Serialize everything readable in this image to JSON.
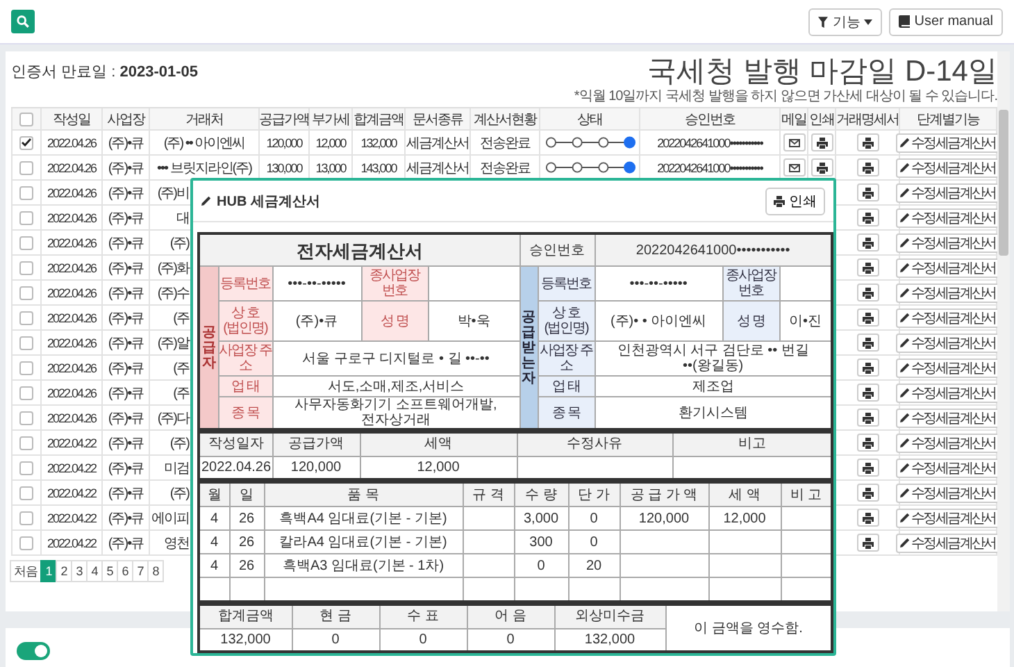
{
  "topbar": {
    "function_button": "기능",
    "manual_button": "User manual"
  },
  "header": {
    "expiry": "인증서 만료일 : **2023-01-05**",
    "deadline": "국세청 발행 마감일 D-14일",
    "note": "*익월 10일까지 국세청 발행을 하지 않으면 가산세 대상이 될 수 있습니다."
  },
  "table": {
    "select_all_checked": false,
    "columns": [
      "작성일",
      "사업장",
      "거래처",
      "공급가액",
      "부가세",
      "합계금액",
      "문서종류",
      "계산서현황",
      "상태",
      "승인번호",
      "메일",
      "인쇄",
      "거래명세서",
      "단계별기능"
    ],
    "rows": [
      {
        "kind": "full",
        "checked": true,
        "date": "2022.04.26",
        "branch": "(주)•큐",
        "client": "(주) •• 아이엔씨",
        "supply": "120,000",
        "vat": "12,000",
        "total": "132,000",
        "doc_type": "세금계산서",
        "status": "전송완료",
        "stages": [
          {
            "selected": false
          },
          {
            "selected": false
          },
          {
            "selected": false
          },
          {
            "selected": true
          }
        ],
        "approval_no": "2022042641000•••••••••••",
        "action": "수정세금계산서"
      },
      {
        "kind": "full",
        "checked": false,
        "date": "2022.04.26",
        "branch": "(주)•큐",
        "client": "••• 브릿지라인(주)",
        "supply": "130,000",
        "vat": "13,000",
        "total": "143,000",
        "doc_type": "세금계산서",
        "status": "전송완료",
        "stages": [
          {
            "selected": false
          },
          {
            "selected": false
          },
          {
            "selected": false
          },
          {
            "selected": true
          }
        ],
        "approval_no": "2022042641000•••••••••••",
        "action": "수정세금계산서"
      },
      {
        "kind": "covered",
        "checked": false,
        "date": "2022.04.26",
        "branch": "(주)•큐",
        "client": "(주)비",
        "action": "수정세금계산서"
      },
      {
        "kind": "covered",
        "checked": false,
        "date": "2022.04.26",
        "branch": "(주)•큐",
        "client": "대",
        "action": "수정세금계산서"
      },
      {
        "kind": "covered",
        "checked": false,
        "date": "2022.04.26",
        "branch": "(주)•큐",
        "client": "(주)",
        "action": "수정세금계산서"
      },
      {
        "kind": "covered",
        "checked": false,
        "date": "2022.04.26",
        "branch": "(주)•큐",
        "client": "(주)화",
        "action": "수정세금계산서"
      },
      {
        "kind": "covered",
        "checked": false,
        "date": "2022.04.26",
        "branch": "(주)•큐",
        "client": "(주)수",
        "action": "수정세금계산서"
      },
      {
        "kind": "covered",
        "checked": false,
        "date": "2022.04.26",
        "branch": "(주)•큐",
        "client": "(주",
        "action": "수정세금계산서"
      },
      {
        "kind": "covered",
        "checked": false,
        "date": "2022.04.26",
        "branch": "(주)•큐",
        "client": "(주)알",
        "action": "수정세금계산서"
      },
      {
        "kind": "covered",
        "checked": false,
        "date": "2022.04.26",
        "branch": "(주)•큐",
        "client": "(주",
        "action": "수정세금계산서"
      },
      {
        "kind": "covered",
        "checked": false,
        "date": "2022.04.26",
        "branch": "(주)•큐",
        "client": "(주",
        "action": "수정세금계산서"
      },
      {
        "kind": "covered",
        "checked": false,
        "date": "2022.04.26",
        "branch": "(주)•큐",
        "client": "(주)다",
        "action": "수정세금계산서"
      },
      {
        "kind": "covered",
        "checked": false,
        "date": "2022.04.22",
        "branch": "(주)•큐",
        "client": "(주)",
        "action": "수정세금계산서"
      },
      {
        "kind": "covered",
        "checked": false,
        "date": "2022.04.22",
        "branch": "(주)•큐",
        "client": "미검",
        "action": "수정세금계산서"
      },
      {
        "kind": "covered",
        "checked": false,
        "date": "2022.04.22",
        "branch": "(주)•큐",
        "client": "(주)",
        "action": "수정세금계산서"
      },
      {
        "kind": "covered",
        "checked": false,
        "date": "2022.04.22",
        "branch": "(주)•큐",
        "client": "에이피",
        "action": "수정세금계산서"
      },
      {
        "kind": "covered",
        "checked": false,
        "date": "2022.04.22",
        "branch": "(주)•큐",
        "client": "영천",
        "action": "수정세금계산서"
      }
    ]
  },
  "pagination": [
    {
      "label": "처음",
      "selected": false
    },
    {
      "label": "1",
      "selected": true
    },
    {
      "label": "2",
      "selected": false
    },
    {
      "label": "3",
      "selected": false
    },
    {
      "label": "4",
      "selected": false
    },
    {
      "label": "5",
      "selected": false
    },
    {
      "label": "6",
      "selected": false
    },
    {
      "label": "7",
      "selected": false
    },
    {
      "label": "8",
      "selected": false
    }
  ],
  "popup": {
    "title": "HUB 세금계산서",
    "print_button": "인쇄",
    "invoice": {
      "heading": "전자세금계산서",
      "approval_label": "승인번호",
      "approval_no": "2022042641000•••••••••••",
      "supplier": {
        "side_label": "공급자",
        "reg_label": "등록번호",
        "reg_no": "•••-••-•••••",
        "sub_label": "종사업장 번호",
        "name_label": "상 호 (법인명)",
        "name": "(주)•큐",
        "rep_label": "성 명",
        "rep": "박•욱",
        "addr_label": "사업장 주 소",
        "addr": "서울 구로구 디지털로 • 길 ••-••",
        "type_label": "업 태",
        "type": "서도,소매,제조,서비스",
        "item_label": "종 목",
        "item": "사무자동화기기 소프트웨어개발,전자상거래"
      },
      "receiver": {
        "side_label": "공급받는자",
        "reg_label": "등록번호",
        "reg_no": "•••-••-•••••",
        "sub_label": "종사업장 번호",
        "name_label": "상 호 (법인명)",
        "name": "(주)• • 아이엔씨",
        "rep_label": "성 명",
        "rep": "이•진",
        "addr_label": "사업장 주 소",
        "addr": "인천광역시 서구 검단로 •• 번길 ••(왕길동)",
        "type_label": "업 태",
        "type": "제조업",
        "item_label": "종 목",
        "item": "환기시스템"
      },
      "summary": {
        "columns": [
          "작성일자",
          "공급가액",
          "세액",
          "수정사유",
          "비고"
        ],
        "values": [
          "2022.04.26",
          "120,000",
          "12,000"
        ]
      },
      "items": {
        "columns": [
          "월",
          "일",
          "품 목",
          "규 격",
          "수 량",
          "단 가",
          "공 급 가 액",
          "세 액",
          "비 고"
        ],
        "rows": [
          {
            "month": "4",
            "day": "26",
            "name": "흑백A4 임대료(기본 - 기본)",
            "qty": "3,000",
            "price": "0",
            "supply": "120,000",
            "tax": "12,000"
          },
          {
            "month": "4",
            "day": "26",
            "name": "칼라A4 임대료(기본 - 기본)",
            "qty": "300",
            "price": "0"
          },
          {
            "month": "4",
            "day": "26",
            "name": "흑백A3 임대료(기본 - 1차)",
            "qty": "0",
            "price": "20"
          }
        ]
      },
      "totals": {
        "columns": [
          "합계금액",
          "현 금",
          "수 표",
          "어 음",
          "외상미수금"
        ],
        "values": [
          "132,000",
          "0",
          "0",
          "0",
          "132,000"
        ],
        "receipt": "이 금액을 영수함."
      }
    }
  },
  "toggle": {
    "on": true
  }
}
